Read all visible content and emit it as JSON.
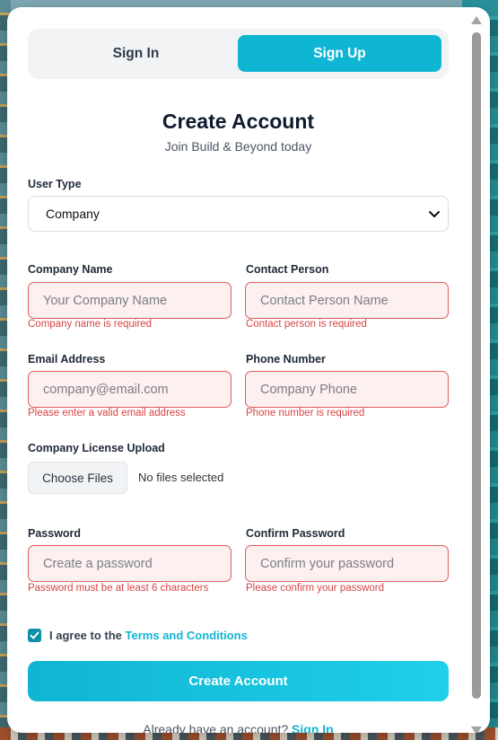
{
  "tabs": {
    "sign_in": "Sign In",
    "sign_up": "Sign Up"
  },
  "header": {
    "title": "Create Account",
    "subtitle": "Join Build & Beyond today"
  },
  "user_type": {
    "label": "User Type",
    "value": "Company"
  },
  "company_name": {
    "label": "Company Name",
    "placeholder": "Your Company Name",
    "error": "Company name is required"
  },
  "contact_person": {
    "label": "Contact Person",
    "placeholder": "Contact Person Name",
    "error": "Contact person is required"
  },
  "email": {
    "label": "Email Address",
    "placeholder": "company@email.com",
    "error": "Please enter a valid email address"
  },
  "phone": {
    "label": "Phone Number",
    "placeholder": "Company Phone",
    "error": "Phone number is required"
  },
  "license": {
    "label": "Company License Upload",
    "button": "Choose Files",
    "status": "No files selected"
  },
  "password": {
    "label": "Password",
    "placeholder": "Create a password",
    "error": "Password must be at least 6 characters"
  },
  "confirm_password": {
    "label": "Confirm Password",
    "placeholder": "Confirm your password",
    "error": "Please confirm your password"
  },
  "terms": {
    "prefix": "I agree to the ",
    "link": "Terms and Conditions",
    "checked": true
  },
  "submit": {
    "label": "Create Account"
  },
  "footer": {
    "text": "Already have an account? ",
    "link": "Sign In"
  },
  "colors": {
    "accent": "#0eb6d4",
    "error": "#d94343",
    "error_bg": "#fdf0f0"
  }
}
